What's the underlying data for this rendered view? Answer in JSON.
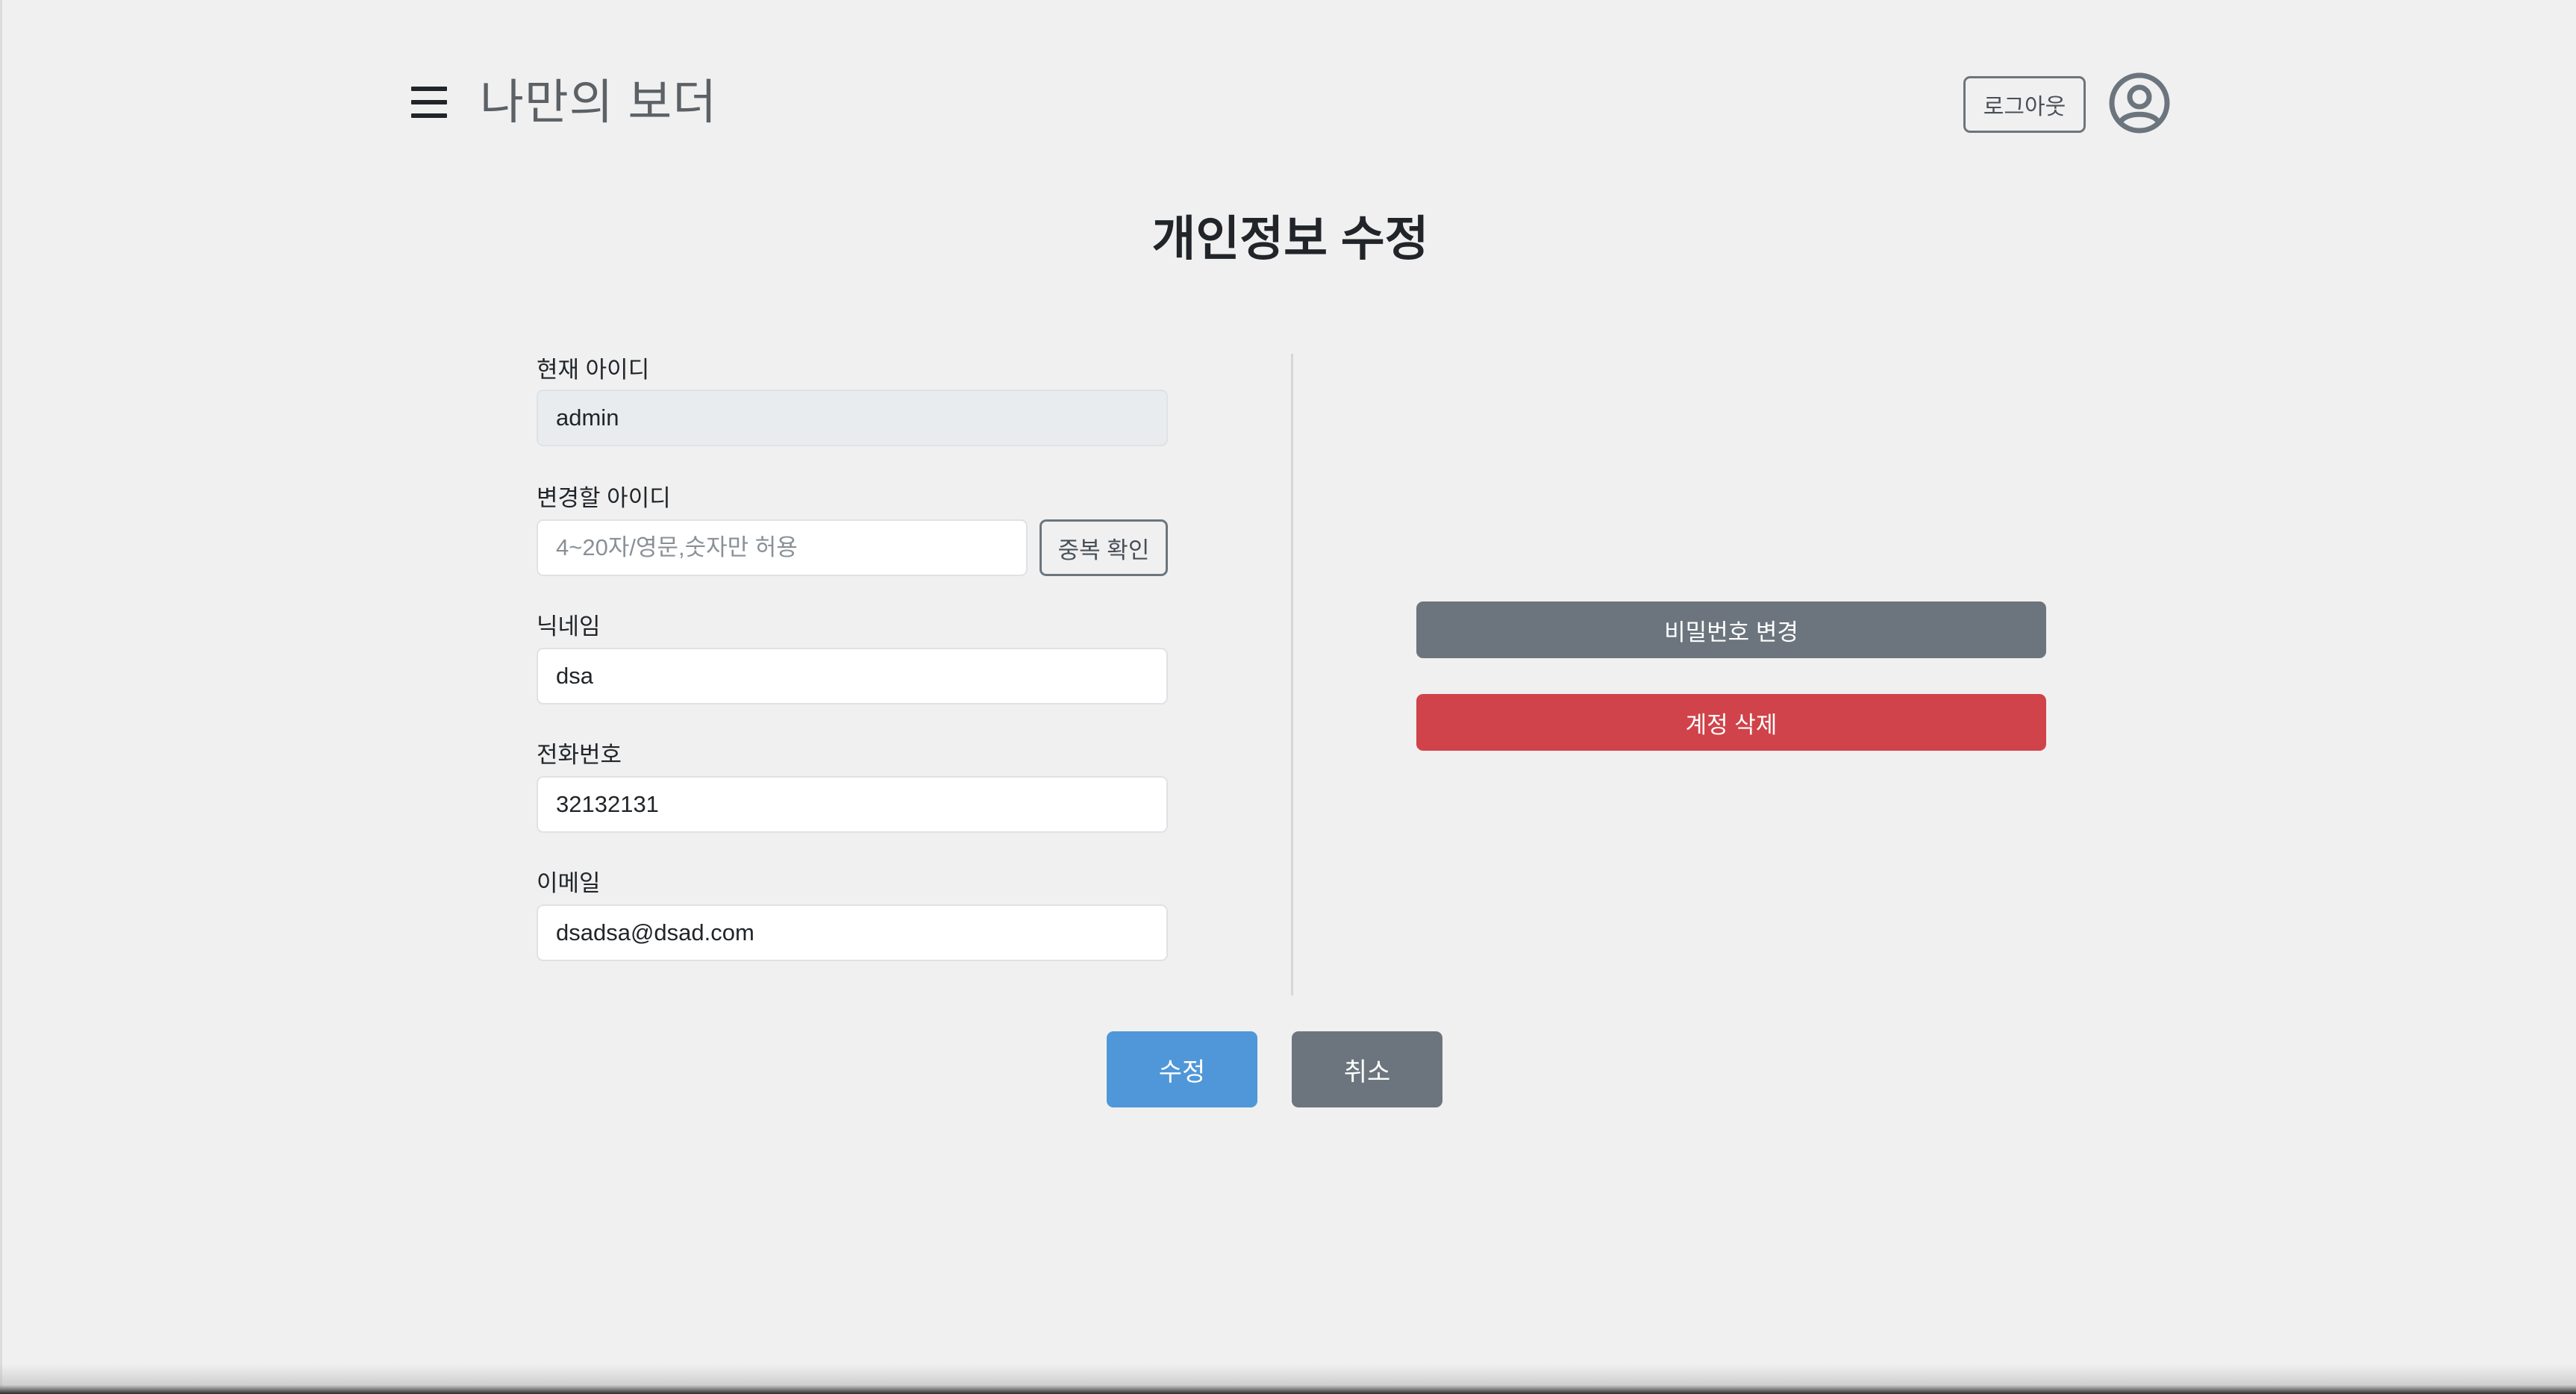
{
  "header": {
    "brand": "나만의 보더",
    "logout_label": "로그아웃"
  },
  "title": "개인정보 수정",
  "form": {
    "current_id": {
      "label": "현재 아이디",
      "value": "admin"
    },
    "new_id": {
      "label": "변경할 아이디",
      "placeholder": "4~20자/영문,숫자만 허용",
      "check_label": "중복 확인"
    },
    "nickname": {
      "label": "닉네임",
      "value": "dsa"
    },
    "phone": {
      "label": "전화번호",
      "value": "32132131"
    },
    "email": {
      "label": "이메일",
      "value": "dsadsa@dsad.com"
    }
  },
  "side": {
    "change_password_label": "비밀번호 변경",
    "delete_account_label": "계정 삭제"
  },
  "actions": {
    "submit_label": "수정",
    "cancel_label": "취소"
  },
  "colors": {
    "primary": "#4f97d8",
    "secondary": "#6c757d",
    "danger": "#d0434a",
    "background": "#f0f0f0"
  },
  "icons": {
    "menu": "hamburger-menu-icon",
    "user": "user-circle-icon"
  }
}
